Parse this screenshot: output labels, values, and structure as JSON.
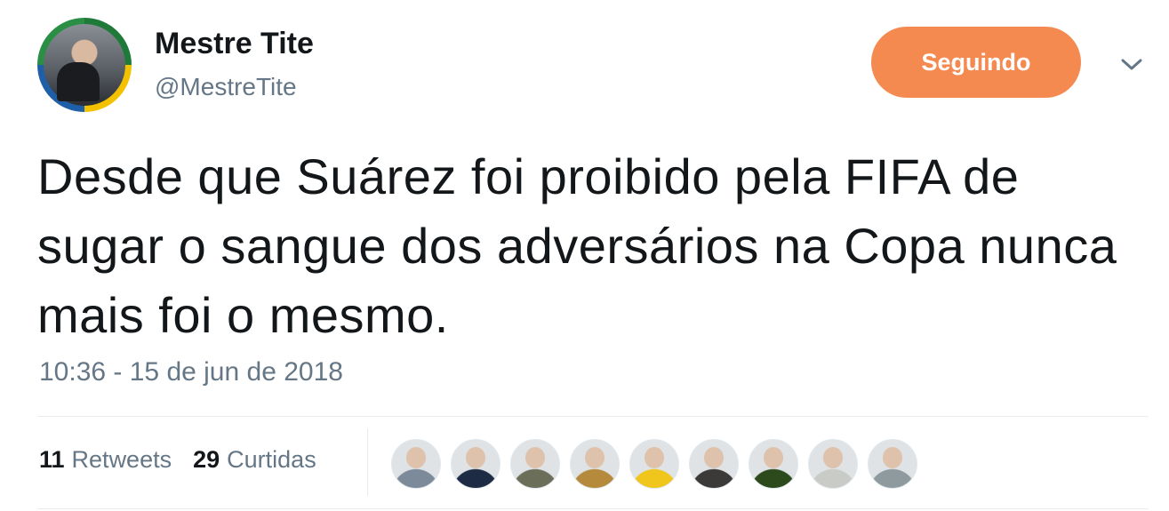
{
  "author": {
    "name": "Mestre Tite",
    "handle": "@MestreTite"
  },
  "follow_button": {
    "label": "Seguindo",
    "color": "#f58a51"
  },
  "tweet": {
    "text": "Desde que Suárez foi proibido pela FIFA de sugar o sangue dos adversários na Copa nunca mais foi o mesmo.",
    "timestamp": "10:36 - 15 de jun de 2018"
  },
  "stats": {
    "retweets": {
      "count": "11",
      "label": "Retweets"
    },
    "likes": {
      "count": "29",
      "label": "Curtidas"
    }
  },
  "likers": [
    {
      "color": "#7c8a99"
    },
    {
      "color": "#1d2b44"
    },
    {
      "color": "#6b6f59"
    },
    {
      "color": "#b58a3c"
    },
    {
      "color": "#f0c51c"
    },
    {
      "color": "#3c3a38"
    },
    {
      "color": "#2d4a1c"
    },
    {
      "color": "#c9cbc7"
    },
    {
      "color": "#8e9a9e"
    }
  ],
  "icons": {
    "menu": "chevron-down-icon"
  }
}
